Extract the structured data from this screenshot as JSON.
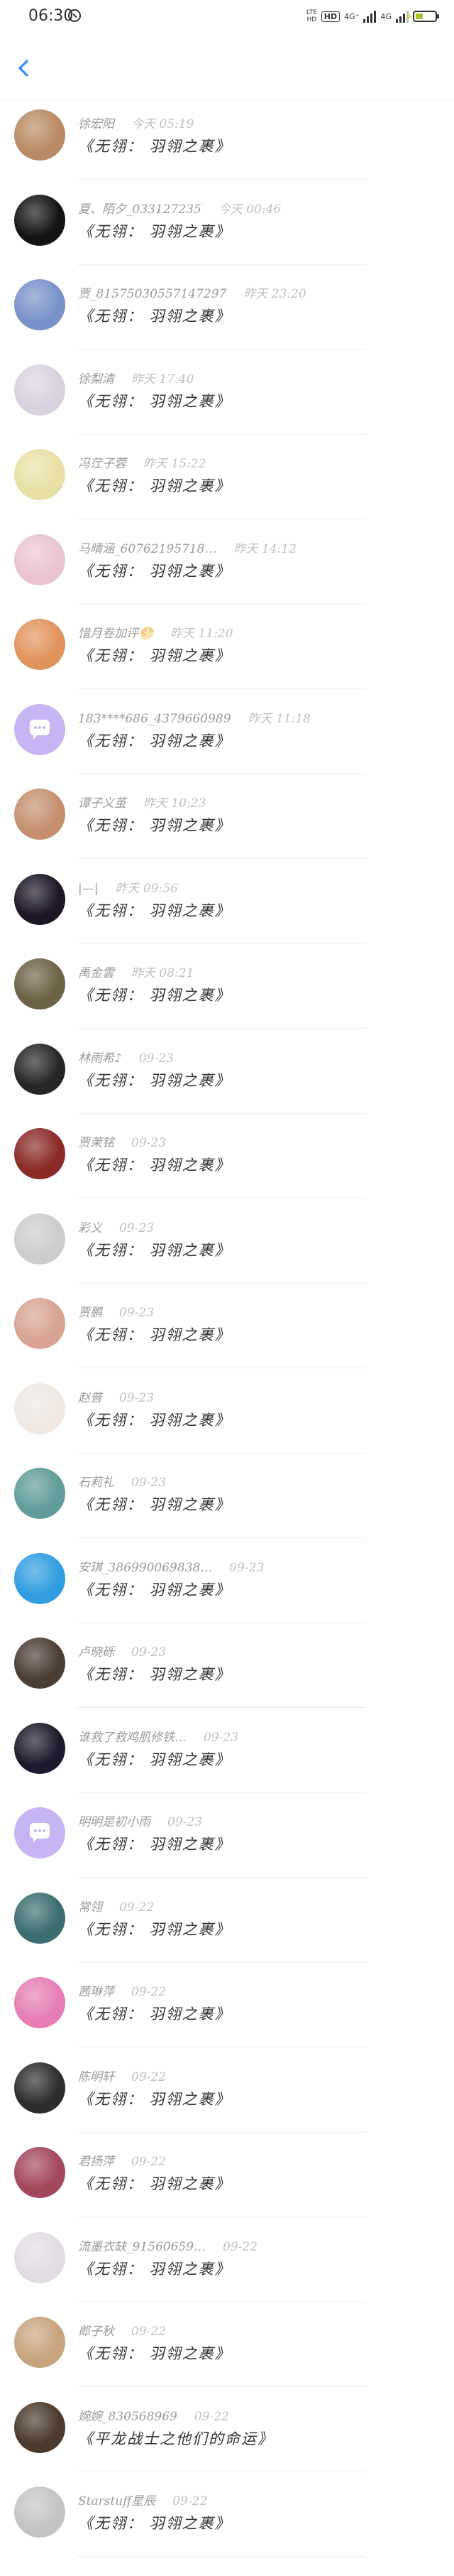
{
  "status_bar": {
    "time": "06:30",
    "small_label_top": "LTE",
    "small_label_bottom": "HD",
    "hd": "HD",
    "net1": "4G⁺",
    "net2": "4G"
  },
  "comment_text": "《无翎： 羽翎之裹》",
  "items": [
    {
      "name": "徐宏阳",
      "time": "今天 05:19",
      "content": "《无翎： 羽翎之裹》",
      "avatar": "#b98a63"
    },
    {
      "name": "夏、陌夕_033127235",
      "time": "今天 00:46",
      "content": "《无翎： 羽翎之裹》",
      "avatar": "#141414"
    },
    {
      "name": "贾_81575030557147297",
      "time": "昨天 23:20",
      "content": "《无翎： 羽翎之裹》",
      "avatar": "#7891c9"
    },
    {
      "name": "徐梨清",
      "time": "昨天 17:40",
      "content": "《无翎： 羽翎之裹》",
      "avatar": "#d9d2de"
    },
    {
      "name": "冯茳子蓉",
      "time": "昨天 15:22",
      "content": "《无翎： 羽翎之裹》",
      "avatar": "#e8e0a4"
    },
    {
      "name": "马晴涵_60762195718…",
      "time": "昨天 14:12",
      "content": "《无翎： 羽翎之裹》",
      "avatar": "#e9c4cf"
    },
    {
      "name": "惜月卷加评🌕",
      "time": "昨天 11:20",
      "content": "《无翎： 羽翎之裹》",
      "avatar": "#e1935c"
    },
    {
      "name": "183****686_4379660989",
      "time": "昨天 11:18",
      "content": "《无翎： 羽翎之裹》",
      "avatar": "placeholder"
    },
    {
      "name": "谭子义茧",
      "time": "昨天 10:23",
      "content": "《无翎： 羽翎之裹》",
      "avatar": "#c58f6e"
    },
    {
      "name": "|—|",
      "time": "昨天 09:56",
      "content": "《无翎： 羽翎之裹》",
      "avatar": "#1c1626"
    },
    {
      "name": "禹金雲",
      "time": "昨天 08:21",
      "content": "《无翎： 羽翎之裹》",
      "avatar": "#6e6245"
    },
    {
      "name": "林雨希♪",
      "time": "09-23",
      "content": "《无翎： 羽翎之裹》",
      "avatar": "#262626"
    },
    {
      "name": "贾茉铭",
      "time": "09-23",
      "content": "《无翎： 羽翎之裹》",
      "avatar": "#8a2a26"
    },
    {
      "name": "彩义",
      "time": "09-23",
      "content": "《无翎： 羽翎之裹》",
      "avatar": "#cccccc"
    },
    {
      "name": "贾鹏",
      "time": "09-23",
      "content": "《无翎： 羽翎之裹》",
      "avatar": "#d8a391"
    },
    {
      "name": "赵普",
      "time": "09-23",
      "content": "《无翎： 羽翎之裹》",
      "avatar": "#efe8e3"
    },
    {
      "name": "石莉礼",
      "time": "09-23",
      "content": "《无翎： 羽翎之裹》",
      "avatar": "#5f9c9a"
    },
    {
      "name": "安琪_386990069838…",
      "time": "09-23",
      "content": "《无翎： 羽翎之裹》",
      "avatar": "#2f9de0"
    },
    {
      "name": "卢晓砾",
      "time": "09-23",
      "content": "《无翎： 羽翎之裹》",
      "avatar": "#4b3d33"
    },
    {
      "name": "谁救了救鸡肌修铁…",
      "time": "09-23",
      "content": "《无翎： 羽翎之裹》",
      "avatar": "#1d1a2d"
    },
    {
      "name": "明明是初小雨",
      "time": "09-23",
      "content": "《无翎： 羽翎之裹》",
      "avatar": "placeholder"
    },
    {
      "name": "常翎",
      "time": "09-22",
      "content": "《无翎： 羽翎之裹》",
      "avatar": "#3b6d71"
    },
    {
      "name": "茜琳萍",
      "time": "09-22",
      "content": "《无翎： 羽翎之裹》",
      "avatar": "#e67db4"
    },
    {
      "name": "陈明轩",
      "time": "09-22",
      "content": "《无翎： 羽翎之裹》",
      "avatar": "#2d2d2d"
    },
    {
      "name": "君扬萍",
      "time": "09-22",
      "content": "《无翎： 羽翎之裹》",
      "avatar": "#a3475c"
    },
    {
      "name": "流墨衣缺_91560659…",
      "time": "09-22",
      "content": "《无翎： 羽翎之裹》",
      "avatar": "#e2dbe4"
    },
    {
      "name": "郎子秋",
      "time": "09-22",
      "content": "《无翎： 羽翎之裹》",
      "avatar": "#c7a47d"
    },
    {
      "name": "婉婉_830568969",
      "time": "09-22",
      "content": "《平龙战士之他们的命运》",
      "avatar": "#4b3a2b"
    },
    {
      "name": "Starstuff星辰",
      "time": "09-22",
      "content": "《无翎： 羽翎之裹》",
      "avatar": "#c4c4c4"
    }
  ]
}
